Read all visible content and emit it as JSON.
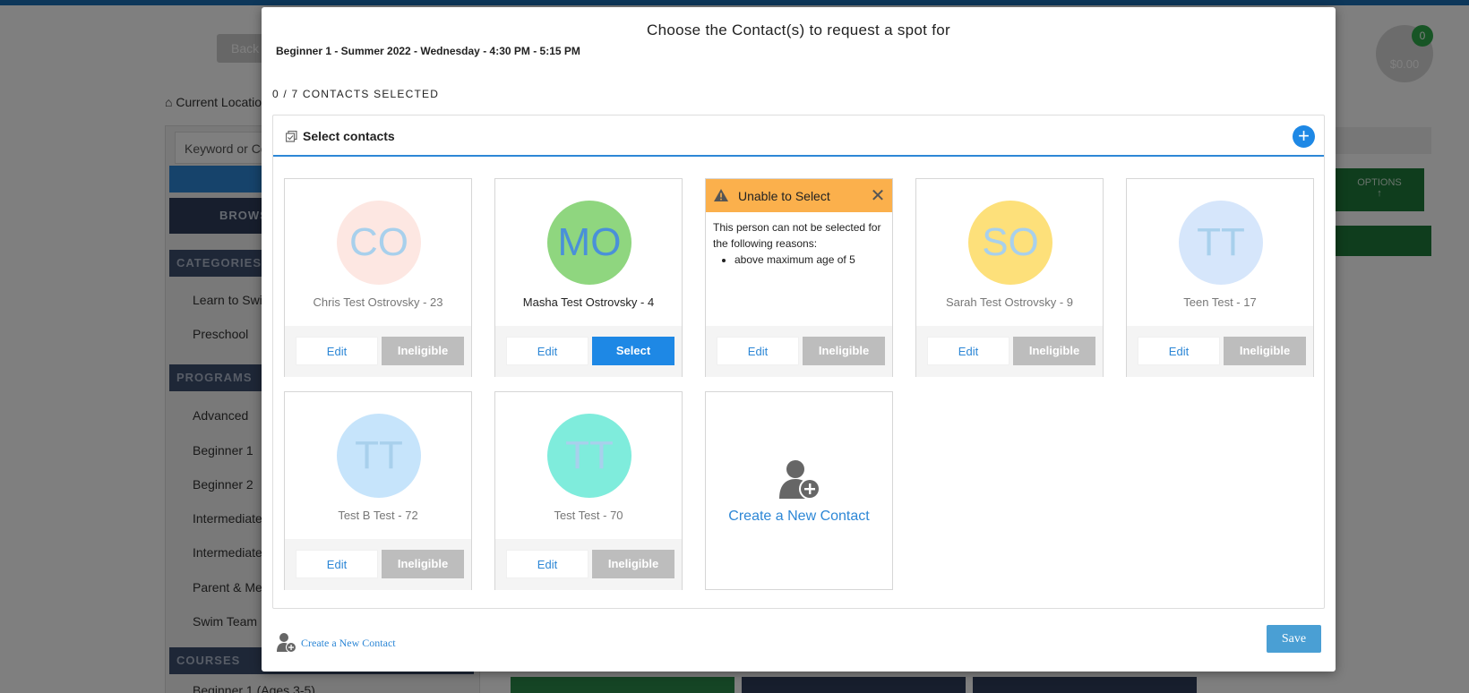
{
  "background": {
    "back_label": "Back",
    "cart_amount": "$0.00",
    "cart_count": "0",
    "current_location": "Current Locatio",
    "search_placeholder": "Keyword or Coc",
    "browse_label": "BROWS",
    "categories_header": "CATEGORIES",
    "categories": [
      "Learn to Swin",
      "Preschool"
    ],
    "programs_header": "PROGRAMS",
    "programs": [
      "Advanced",
      "Beginner 1",
      "Beginner 2",
      "Intermediate",
      "Intermediate",
      "Parent & Me",
      "Swim Team Pi"
    ],
    "courses_header": "COURSES",
    "courses": [
      "Beginner 1 (Ages 3-5)"
    ],
    "options_label": "OPTIONS"
  },
  "modal": {
    "title": "Choose the Contact(s) to request a spot for",
    "subtitle": "Beginner 1 - Summer 2022 - Wednesday - 4:30 PM - 5:15 PM",
    "selected_count": "0 / 7 CONTACTS SELECTED",
    "panel_title": "Select contacts",
    "add_symbol": "+",
    "contacts": [
      {
        "initials": "CO",
        "name": "Chris Test Ostrovsky - 23",
        "edit": "Edit",
        "action": "Ineligible",
        "eligible": false,
        "bg": "#fde7e2",
        "fg": "#a8d0ec"
      },
      {
        "initials": "MO",
        "name": "Masha Test Ostrovsky - 4",
        "edit": "Edit",
        "action": "Select",
        "eligible": true,
        "bg": "#8fd67f",
        "fg": "#4a90d9"
      },
      {
        "initials": "SO",
        "name": "Sarah Test Ostrovsky - 9",
        "edit": "Edit",
        "action": "Ineligible",
        "eligible": false,
        "bg": "#fde07a",
        "fg": "#a8d0ec"
      },
      {
        "initials": "TT",
        "name": "Teen Test - 17",
        "edit": "Edit",
        "action": "Ineligible",
        "eligible": false,
        "bg": "#d6e6fb",
        "fg": "#a8d0ec"
      },
      {
        "initials": "TT",
        "name": "Test B Test - 72",
        "edit": "Edit",
        "action": "Ineligible",
        "eligible": false,
        "bg": "#c6e4fb",
        "fg": "#a8d0ec"
      },
      {
        "initials": "TT",
        "name": "Test Test - 70",
        "edit": "Edit",
        "action": "Ineligible",
        "eligible": false,
        "bg": "#7fecdc",
        "fg": "#a8d0ec"
      }
    ],
    "warning": {
      "title": "Unable to Select",
      "close": "✕",
      "message": "This person can not be selected for the following reasons:",
      "reasons": [
        "above maximum age of 5"
      ],
      "edit": "Edit",
      "action": "Ineligible"
    },
    "new_contact_card_label": "Create a New Contact",
    "footer_link": "Create a New Contact",
    "save_label": "Save"
  },
  "colors": {
    "accent": "#1e88e5",
    "link": "#2d87d6",
    "warning": "#fbb04c",
    "ineligible": "#bdbdbd",
    "save": "#4a9fd4"
  }
}
